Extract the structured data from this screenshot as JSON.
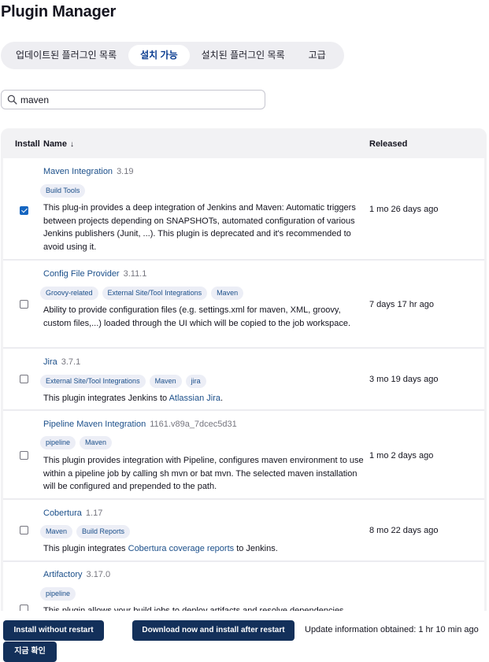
{
  "page": {
    "title": "Plugin Manager"
  },
  "tabs": [
    {
      "label": "업데이트된 플러그인 목록"
    },
    {
      "label": "설치 가능"
    },
    {
      "label": "설치된 플러그인 목록"
    },
    {
      "label": "고급"
    }
  ],
  "search": {
    "value": "maven"
  },
  "table": {
    "headers": {
      "install": "Install",
      "name": "Name",
      "sort": "↓",
      "released": "Released"
    },
    "rows": [
      {
        "name": "Maven Integration",
        "version": "3.19",
        "checked": true,
        "tags": [
          "Build Tools"
        ],
        "description": "This plug-in provides a deep integration of Jenkins and Maven: Automatic triggers between projects depending on SNAPSHOTs, automated configuration of various Jenkins publishers (Junit, ...). This plugin is deprecated and it's recommended to avoid using it.",
        "released": "1 mo 26 days ago"
      },
      {
        "name": "Config File Provider",
        "version": "3.11.1",
        "checked": false,
        "tags": [
          "Groovy-related",
          "External Site/Tool Integrations",
          "Maven"
        ],
        "description": "Ability to provide configuration files (e.g. settings.xml for maven, XML, groovy, custom files,...) loaded through the UI which will be copied to the job workspace.",
        "released": "7 days 17 hr ago"
      },
      {
        "name": "Jira",
        "version": "3.7.1",
        "checked": false,
        "tags": [
          "External Site/Tool Integrations",
          "Maven",
          "jira"
        ],
        "description_pre": "This plugin integrates Jenkins to ",
        "description_link": "Atlassian Jira",
        "description_post": ".",
        "released": "3 mo 19 days ago"
      },
      {
        "name": "Pipeline Maven Integration",
        "version": "1161.v89a_7dcec5d31",
        "checked": false,
        "tags": [
          "pipeline",
          "Maven"
        ],
        "description": "This plugin provides integration with Pipeline, configures maven environment to use within a pipeline job by calling sh mvn or bat mvn. The selected maven installation will be configured and prepended to the path.",
        "released": "1 mo 2 days ago"
      },
      {
        "name": "Cobertura",
        "version": "1.17",
        "checked": false,
        "tags": [
          "Maven",
          "Build Reports"
        ],
        "description_pre": "This plugin integrates ",
        "description_link": "Cobertura coverage reports",
        "description_post": " to Jenkins.",
        "released": "8 mo 22 days ago"
      },
      {
        "name": "Artifactory",
        "version": "3.17.0",
        "checked": false,
        "tags": [
          "pipeline"
        ],
        "description": "This plugin allows your build jobs to deploy artifacts and resolve dependencies",
        "released": ""
      }
    ]
  },
  "footer": {
    "install_without_restart": "Install without restart",
    "download_install_after_restart": "Download now and install after restart",
    "update_info": "Update information obtained: 1 hr 10 min ago",
    "check_now": "지금 확인"
  },
  "colors": {
    "primary_button": "#13305a",
    "link": "#1b4f8a",
    "checkbox_checked": "#1565c0"
  }
}
